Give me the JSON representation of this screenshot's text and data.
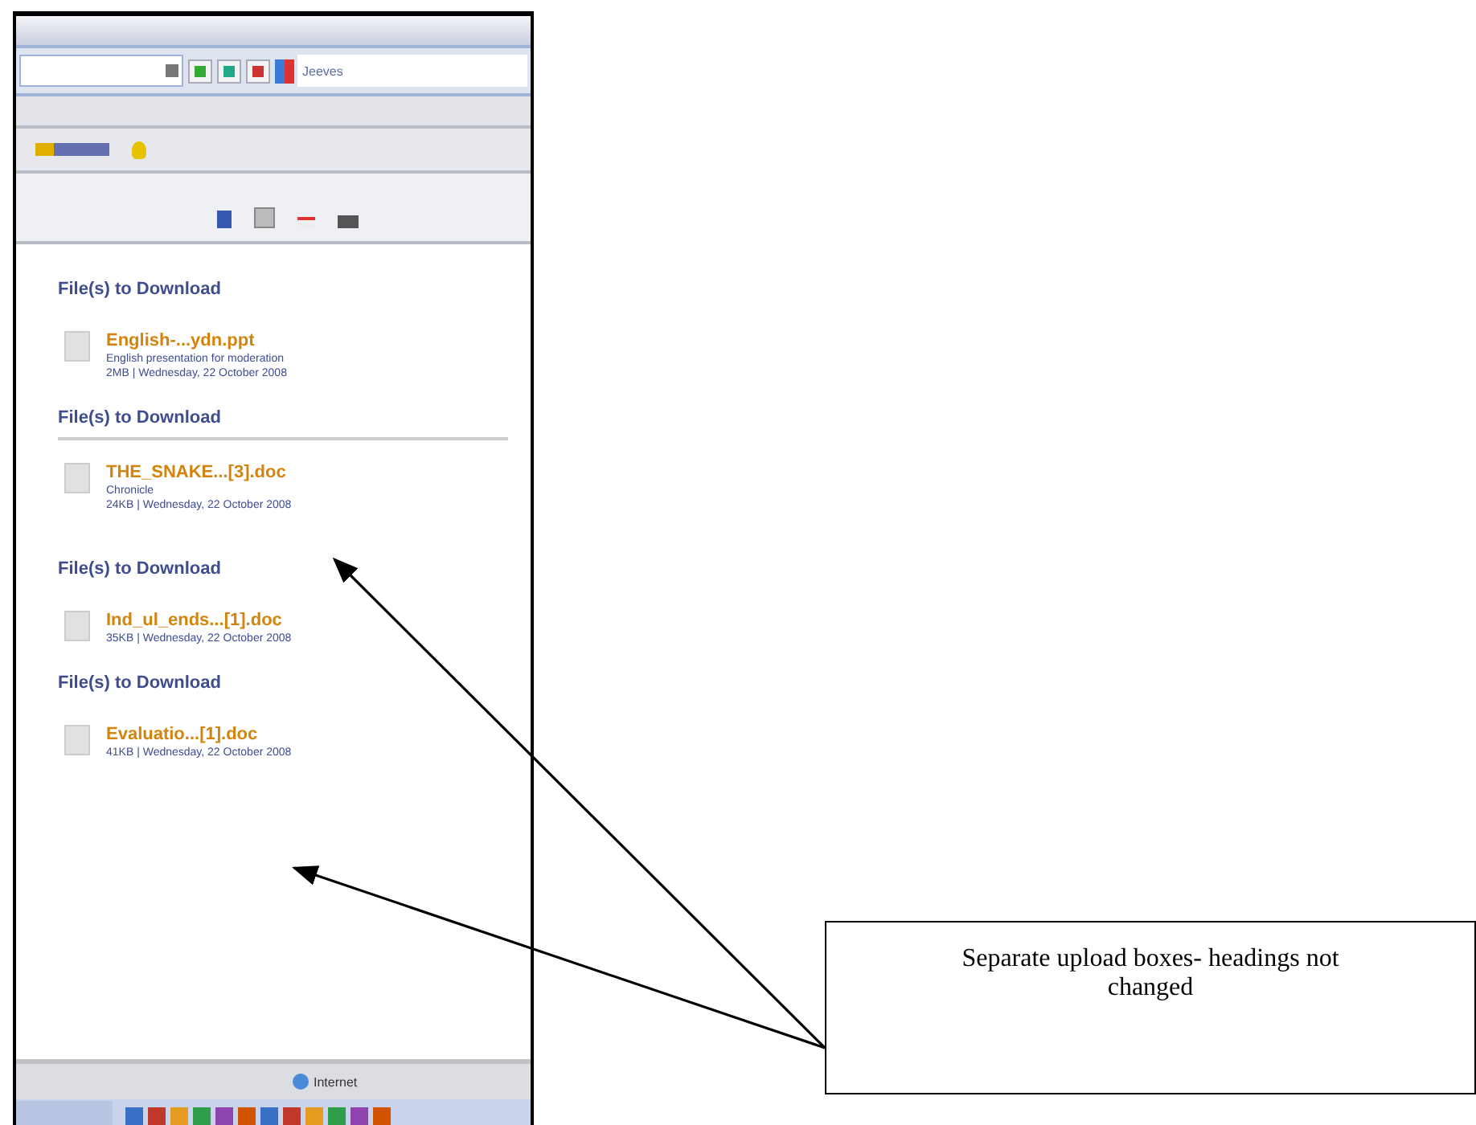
{
  "browser": {
    "search_placeholder": "Jeeves",
    "status_zone": "Internet"
  },
  "sections": [
    {
      "heading": "File(s) to Download",
      "divider": false,
      "file": {
        "name": "English-...ydn.ppt",
        "lines": [
          "English presentation for moderation",
          "2MB | Wednesday, 22 October 2008"
        ]
      }
    },
    {
      "heading": "File(s) to Download",
      "divider": true,
      "file": {
        "name": "THE_SNAKE...[3].doc",
        "lines": [
          "Chronicle",
          "24KB | Wednesday, 22 October 2008"
        ]
      }
    },
    {
      "heading": "File(s) to Download",
      "divider": false,
      "file": {
        "name": "Ind_ul_ends...[1].doc",
        "lines": [
          "35KB | Wednesday, 22 October 2008"
        ]
      }
    },
    {
      "heading": "File(s) to Download",
      "divider": false,
      "file": {
        "name": "Evaluatio...[1].doc",
        "lines": [
          "41KB | Wednesday, 22 October 2008"
        ]
      }
    }
  ],
  "callout": {
    "text": "Separate upload boxes- headings not changed"
  }
}
